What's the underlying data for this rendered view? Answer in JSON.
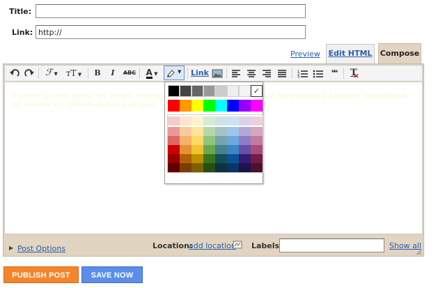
{
  "form": {
    "title_label": "Title:",
    "title_value": "",
    "link_label": "Link:",
    "link_value": "http://"
  },
  "tabs": {
    "preview": "Preview",
    "edit_html": "Edit HTML",
    "compose": "Compose"
  },
  "toolbar": {
    "undo_icon": "undo-icon",
    "redo_icon": "redo-icon",
    "font_glyph": "ℱ",
    "font_size_glyph": "тT",
    "bold": "B",
    "italic": "I",
    "strike": "ABC",
    "text_color_glyph": "A",
    "link": "Link",
    "quote_glyph": "❝❝",
    "clear_glyph": "T"
  },
  "editor": {
    "faint_text": "Lorem ipsum dolor sit amet, consectetur adipiscing elit. Sed do eiusmod tempor incididunt ut labore et dolore magna aliqua."
  },
  "color_picker": {
    "grays": [
      "#000000",
      "#434343",
      "#666666",
      "#999999",
      "#cccccc",
      "#efefef",
      "#f3f3f3",
      "#ffffff"
    ],
    "brights": [
      "#ff0000",
      "#ff9900",
      "#ffff00",
      "#00ff00",
      "#00ffff",
      "#0000ff",
      "#9900ff",
      "#ff00ff"
    ],
    "palette": [
      [
        "#f4cccc",
        "#fce5cd",
        "#fff2cc",
        "#d9ead3",
        "#d0e0e3",
        "#cfe2f3",
        "#d9d2e9",
        "#ead1dc"
      ],
      [
        "#ea9999",
        "#f9cb9c",
        "#ffe599",
        "#b6d7a8",
        "#a2c4c9",
        "#9fc5e8",
        "#b4a7d6",
        "#d5a6bd"
      ],
      [
        "#e06666",
        "#f6b26b",
        "#ffd966",
        "#93c47d",
        "#76a5af",
        "#6fa8dc",
        "#8e7cc3",
        "#c27ba0"
      ],
      [
        "#cc0000",
        "#e69138",
        "#f1c232",
        "#6aa84f",
        "#45818e",
        "#3d85c6",
        "#674ea7",
        "#a64d79"
      ],
      [
        "#990000",
        "#b45f06",
        "#bf9000",
        "#38761d",
        "#134f5c",
        "#0b5394",
        "#351c75",
        "#741b47"
      ],
      [
        "#660000",
        "#783f04",
        "#7f6000",
        "#274e13",
        "#0c343d",
        "#073763",
        "#20124d",
        "#4c1130"
      ]
    ],
    "selected_index": 7
  },
  "bottom": {
    "post_options": "Post Options",
    "location_label": "Location:",
    "add_location": "add location",
    "labels_label": "Labels:",
    "labels_value": "",
    "show_all": "Show all"
  },
  "buttons": {
    "publish": "PUBLISH POST",
    "save": "SAVE NOW"
  },
  "colors": {
    "publish_bg": "#f4852b",
    "save_bg": "#5b8ee8",
    "link": "#2a5db0",
    "editor_frame": "#e1d4c0"
  }
}
